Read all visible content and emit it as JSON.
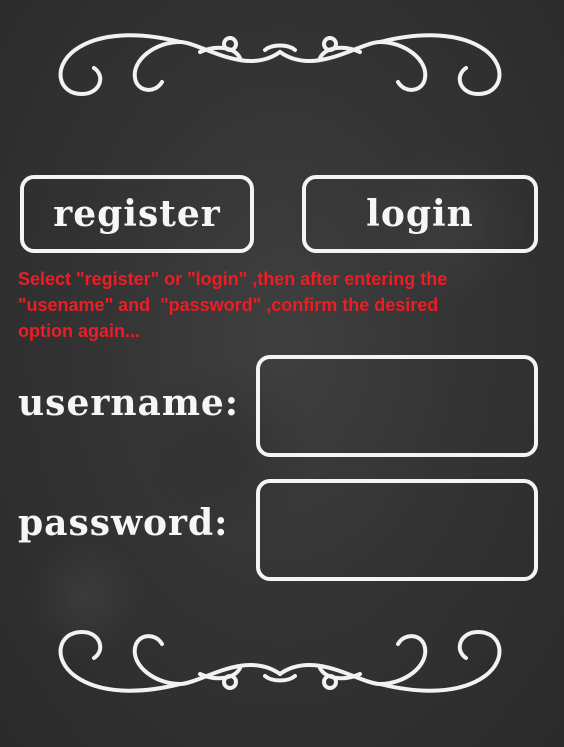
{
  "colors": {
    "background": "#353535",
    "chalk": "#f4f4f4",
    "instruction_text": "#ee1c24"
  },
  "buttons": {
    "register_label": "register",
    "login_label": "login"
  },
  "instructions": {
    "line1": "Select \"register\" or \"login\" ,then after entering the",
    "line2": "\"usename\" and  \"password\" ,confirm the desired",
    "line3": "option again..."
  },
  "form": {
    "username_label": "username:",
    "username_value": "",
    "password_label": "password:",
    "password_value": ""
  },
  "icons": {
    "top_ornament": "flourish-ornament-icon",
    "bottom_ornament": "flourish-ornament-icon"
  }
}
